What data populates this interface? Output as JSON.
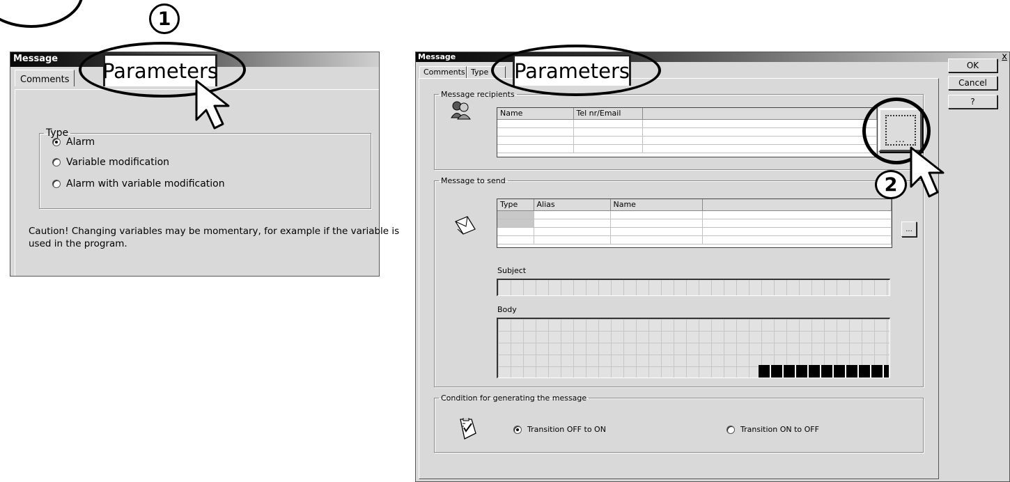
{
  "left_window": {
    "title": "Message",
    "tabs": [
      "Comments"
    ],
    "callout_tab": "Parameters",
    "step_marker": "1",
    "type_group": {
      "legend": "Type",
      "options": [
        {
          "label": "Alarm",
          "selected": true
        },
        {
          "label": "Variable modification",
          "selected": false
        },
        {
          "label": "Alarm with variable modification",
          "selected": false
        }
      ]
    },
    "caution_line1": "Caution! Changing variables may be momentary, for example if the variable is",
    "caution_line2": "used in the program."
  },
  "right_window": {
    "title": "Message",
    "close_glyph": "x",
    "tabs": [
      "Comments",
      "Type"
    ],
    "callout_tab": "Parameters",
    "step_marker": "2",
    "buttons": {
      "ok": "OK",
      "cancel": "Cancel",
      "help": "?"
    },
    "recipients": {
      "legend": "Message recipients",
      "columns": [
        "Name",
        "Tel nr/Email",
        ""
      ],
      "browse_label": "..."
    },
    "message_to_send": {
      "legend": "Message to send",
      "columns": [
        "Type",
        "Alias",
        "Name",
        ""
      ],
      "browse_label": "...",
      "subject_label": "Subject",
      "body_label": "Body"
    },
    "condition": {
      "legend": "Condition for generating the message",
      "options": [
        {
          "label": "Transition OFF to ON",
          "selected": true
        },
        {
          "label": "Transition ON to OFF",
          "selected": false
        }
      ]
    }
  },
  "colors": {
    "window_bg": "#d9d9d9",
    "title_start": "#050505",
    "title_end": "#d0d0d0"
  },
  "icons": [
    "users-icon",
    "message-envelope-icon",
    "condition-checklist-icon",
    "pointer-cursor-icon"
  ]
}
